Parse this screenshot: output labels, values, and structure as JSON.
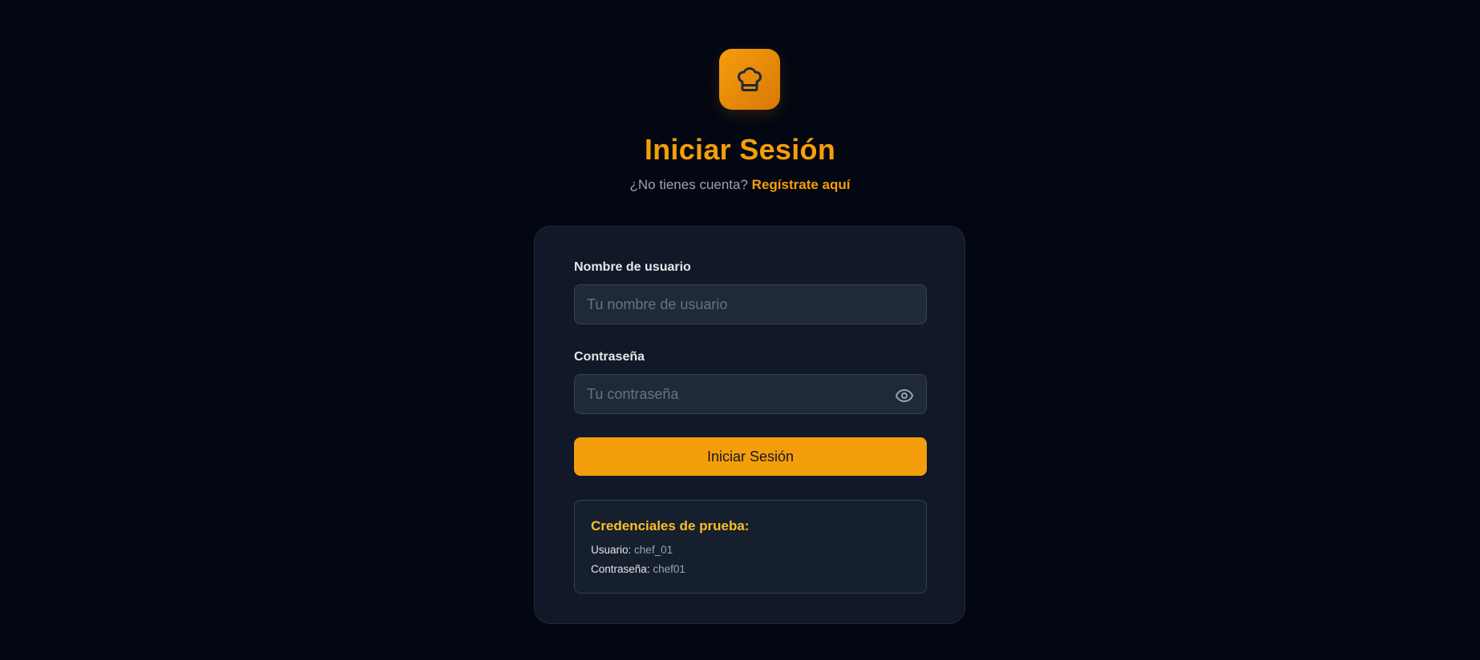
{
  "logo": {
    "icon": "chef-hat-icon",
    "accent": "#f59e0b"
  },
  "header": {
    "title": "Iniciar Sesión",
    "prompt": "¿No tienes cuenta?",
    "register_link": "Regístrate aquí"
  },
  "form": {
    "username": {
      "label": "Nombre de usuario",
      "placeholder": "Tu nombre de usuario",
      "value": ""
    },
    "password": {
      "label": "Contraseña",
      "placeholder": "Tu contraseña",
      "value": "",
      "toggle_icon": "eye-icon"
    },
    "submit_label": "Iniciar Sesión"
  },
  "test_credentials": {
    "title": "Credenciales de prueba:",
    "user_label": "Usuario:",
    "user_value": "chef_01",
    "password_label": "Contraseña:",
    "password_value": "chef01"
  },
  "colors": {
    "background": "#030712",
    "card": "#111827",
    "accent": "#f59e0b",
    "input_bg": "#1f2937"
  }
}
